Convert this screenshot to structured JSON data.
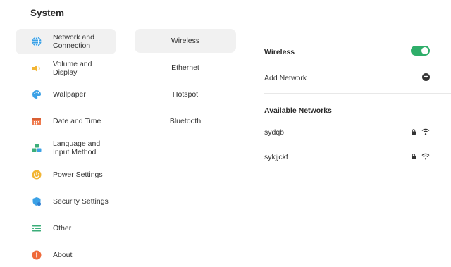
{
  "page": {
    "title": "System"
  },
  "sidebar": {
    "items": [
      {
        "label": "Network and Connection",
        "icon": "globe-icon",
        "color": "#3ba1e6",
        "active": true
      },
      {
        "label": "Volume and Display",
        "icon": "speaker-icon",
        "color": "#f2b534"
      },
      {
        "label": "Wallpaper",
        "icon": "palette-icon",
        "color": "#3ba1e6"
      },
      {
        "label": "Date and Time",
        "icon": "calendar-icon",
        "color": "#ef7a4d"
      },
      {
        "label": "Language and Input Method",
        "icon": "language-blocks-icon",
        "color": "#3cae7a"
      },
      {
        "label": "Power Settings",
        "icon": "power-icon",
        "color": "#f2b534"
      },
      {
        "label": "Security Settings",
        "icon": "shield-icon",
        "color": "#3ba1e6"
      },
      {
        "label": "Other",
        "icon": "list-icon",
        "color": "#3cae7a"
      },
      {
        "label": "About",
        "icon": "info-icon",
        "color": "#ef6a3a"
      }
    ]
  },
  "midlist": {
    "items": [
      {
        "label": "Wireless",
        "active": true
      },
      {
        "label": "Ethernet"
      },
      {
        "label": "Hotspot"
      },
      {
        "label": "Bluetooth"
      }
    ]
  },
  "panel": {
    "wireless_label": "Wireless",
    "wireless_on": true,
    "add_network_label": "Add Network",
    "available_label": "Available Networks",
    "networks": [
      {
        "ssid": "sydqb",
        "secured": true
      },
      {
        "ssid": "sykjjckf",
        "secured": true
      }
    ]
  },
  "colors": {
    "accent_green": "#2fae6a",
    "active_bg": "#f1f1f1"
  }
}
